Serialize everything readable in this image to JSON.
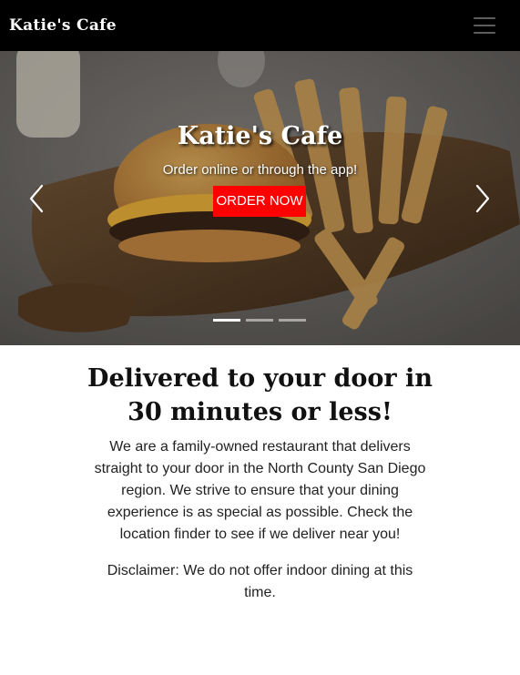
{
  "navbar": {
    "brand": "Katie's Cafe",
    "toggle_icon": "hamburger-menu-icon"
  },
  "carousel": {
    "title": "Katie's Cafe",
    "subtitle": "Order online or through the app!",
    "cta_label": "ORDER NOW",
    "prev_icon": "chevron-left-icon",
    "next_icon": "chevron-right-icon",
    "slide_count": 3,
    "active_slide": 1
  },
  "main": {
    "headline": "Delivered to your door in 30 minutes or less!",
    "intro": "We are a family-owned restaurant that delivers straight to your door in the North County San Diego region. We strive to ensure that your dining experience is as special as possible. Check the location finder to see if we deliver near you!",
    "disclaimer": "Disclaimer: We do not offer indoor dining at this time."
  },
  "colors": {
    "navbar_bg": "#000000",
    "cta_bg": "#ff0000",
    "text": "#222222"
  }
}
